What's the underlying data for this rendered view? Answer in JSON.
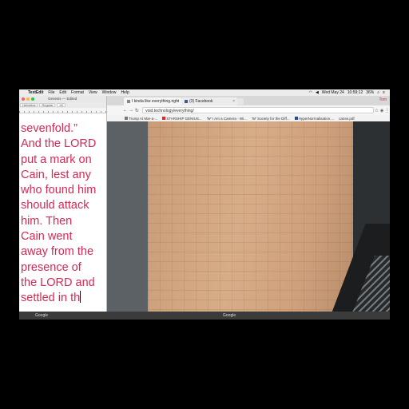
{
  "menubar": {
    "app_name": "TextEdit",
    "items": [
      "File",
      "Edit",
      "Format",
      "View",
      "Window",
      "Help"
    ],
    "date": "Wed May 24",
    "time": "10:59:12",
    "battery": "36%"
  },
  "textedit": {
    "window_title": "Genesis — Edited",
    "font_family": "Helvetica",
    "font_style": "Regular",
    "font_size": "42",
    "lines": [
      "sevenfold.”",
      "And the LORD",
      "put a mark on",
      "Cain, lest any",
      "who found him",
      "should attack",
      "him. Then",
      "Cain went",
      "away from the",
      "presence of",
      "the LORD and",
      "settled in th"
    ]
  },
  "browser": {
    "tabs": [
      {
        "label": "I kinda like everything.right",
        "icon": "page-icon",
        "active": true
      },
      {
        "label": "(3) Facebook",
        "icon": "facebook-icon",
        "active": false
      }
    ],
    "profile": "Tom",
    "url": "void.technology/everything/",
    "bookmarks": [
      {
        "label": "Trump At Mar-a-...",
        "icon": "page-icon"
      },
      {
        "label": "STARSHIP GENIUS...",
        "icon": "youtube-icon"
      },
      {
        "label": "'W' I Am a Camera - Wi...",
        "icon": "wikipedia-icon"
      },
      {
        "label": "'W' Society for the Diff...",
        "icon": "wikipedia-icon"
      },
      {
        "label": "HyperNormalisation....",
        "icon": "page-icon"
      },
      {
        "label": "canse.pdf",
        "icon": "pdf-icon"
      }
    ]
  },
  "dock": {
    "left_label": "Google",
    "right_label": "Google"
  },
  "colors": {
    "text_pink": "#d62a52",
    "wall": "#d0a47f"
  }
}
